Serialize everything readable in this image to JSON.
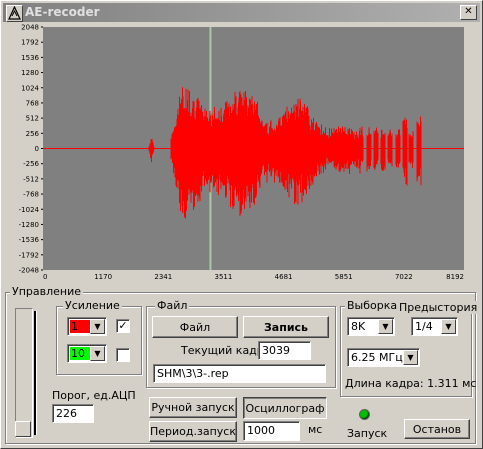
{
  "window": {
    "title": "AE-recoder",
    "close_symbol": "✕"
  },
  "scope": {
    "bg_color": "#808080",
    "signal_color": "#ff0000",
    "y_ticks": [
      "2048",
      "1792",
      "1536",
      "1280",
      "1024",
      "768",
      "512",
      "256",
      "0",
      "-256",
      "-512",
      "-768",
      "-1024",
      "-1280",
      "-1536",
      "-1792",
      "-2048"
    ],
    "x_ticks": [
      "0",
      "1170",
      "2341",
      "3511",
      "4681",
      "5851",
      "7022",
      "8192"
    ]
  },
  "control": {
    "group_label": "Управление",
    "gain": {
      "label": "Усиление",
      "ch1_value": "1",
      "ch1_color": "#ff0000",
      "ch1_checked": true,
      "ch2_value": "10",
      "ch2_color": "#00ff00",
      "ch2_checked": false
    },
    "threshold": {
      "label": "Порог, ед.АЦП",
      "value": "226"
    },
    "file": {
      "label": "Файл",
      "file_button": "Файл",
      "record_button": "Запись",
      "frame_label": "Текущий кадр:",
      "frame_value": "3039",
      "path": "SHM\\3\\3-.rep"
    },
    "sampling": {
      "label": "Выборка",
      "value": "8K",
      "prehistory_label": "Предыстория",
      "prehistory_value": "1/4",
      "freq_value": "6.25 МГц",
      "frame_length": "Длина кадра: 1.311 мс"
    },
    "buttons": {
      "manual": "Ручной запуск",
      "oscillograph": "Осциллограф",
      "periodic": "Период.запуск",
      "stop": "Останов"
    },
    "period": {
      "value": "1000",
      "unit": "мс"
    },
    "start": {
      "label": "Запуск",
      "led_color": "#00c000"
    },
    "arrow_symbol": "▼",
    "check_symbol": "✓"
  }
}
